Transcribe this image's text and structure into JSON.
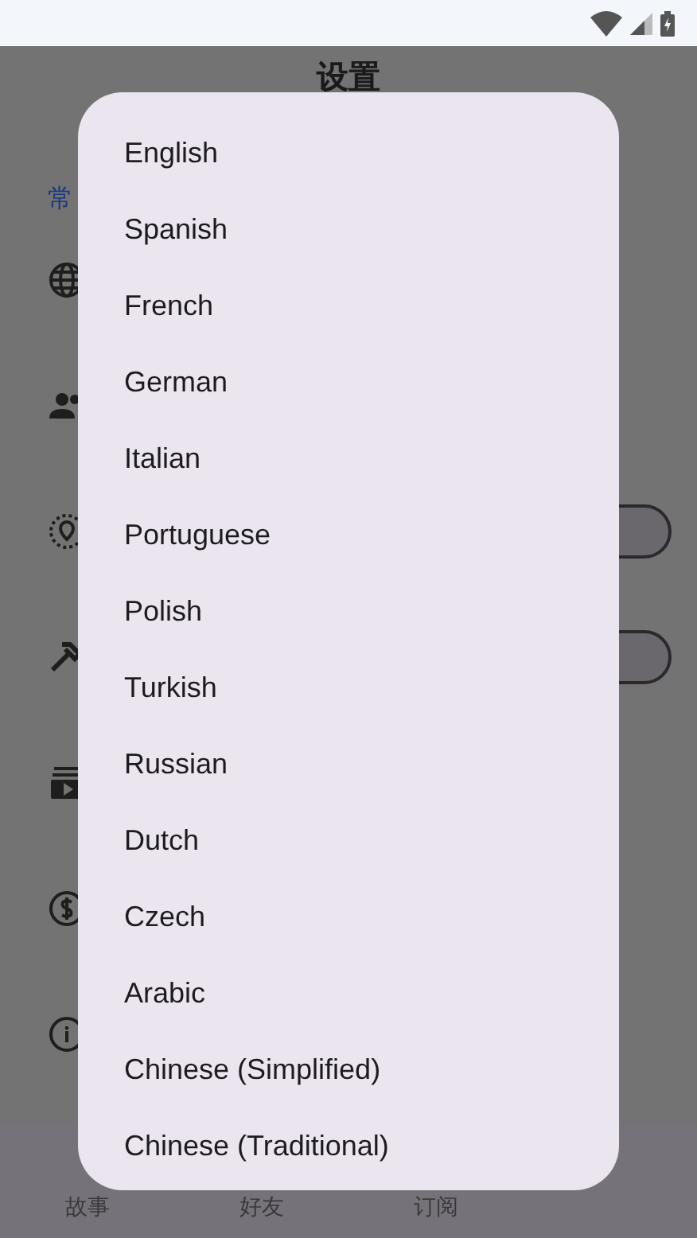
{
  "app_bar": {
    "title": "设置"
  },
  "section_header": "常",
  "switches": [
    {
      "on": false
    },
    {
      "on": false
    }
  ],
  "bottom_nav": [
    {
      "label": "故事"
    },
    {
      "label": "好友"
    },
    {
      "label": "订阅"
    }
  ],
  "language_dialog": {
    "options": [
      "English",
      "Spanish",
      "French",
      "German",
      "Italian",
      "Portuguese",
      "Polish",
      "Turkish",
      "Russian",
      "Dutch",
      "Czech",
      "Arabic",
      "Chinese (Simplified)",
      "Chinese (Traditional)"
    ]
  }
}
